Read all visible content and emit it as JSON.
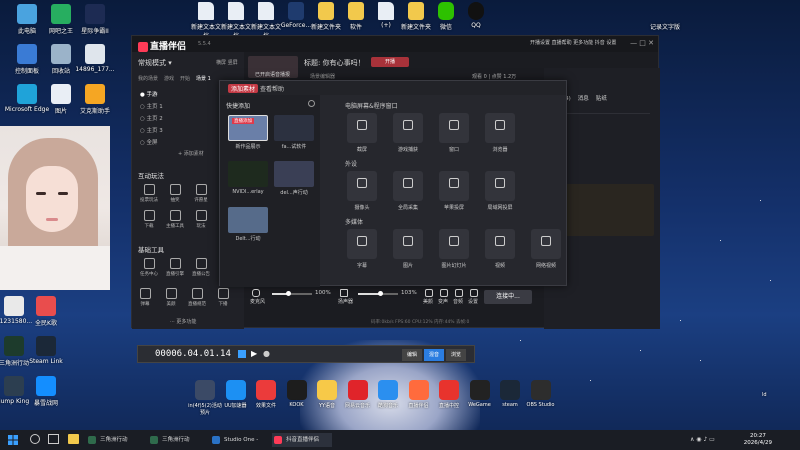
{
  "desktop_left": [
    {
      "label": "此电脑",
      "color": "#4aa3df"
    },
    {
      "label": "网吧之王",
      "color": "#27ae60"
    },
    {
      "label": "星际争霸II",
      "color": "#1d2b53"
    },
    {
      "label": "控制面板",
      "color": "#3a7bd5"
    },
    {
      "label": "回收站",
      "color": "#9bb3c9"
    },
    {
      "label": "14896_177...",
      "color": "#dfe5ec"
    },
    {
      "label": "Microsoft Edge",
      "color": "#1fa3d9"
    },
    {
      "label": "图片",
      "color": "#e9eef5"
    },
    {
      "label": "艾克斯助手",
      "color": "#f5a623"
    }
  ],
  "desktop_top": [
    {
      "label": "新建文本文档",
      "type": "file"
    },
    {
      "label": "新建文本文档",
      "type": "file"
    },
    {
      "label": "新建文本文档",
      "type": "file"
    },
    {
      "label": "GeForce...",
      "type": "app"
    },
    {
      "label": "新建文件夹",
      "type": "folder"
    },
    {
      "label": "软件",
      "type": "folder"
    },
    {
      "label": "(+)",
      "type": "file"
    },
    {
      "label": "新建文件夹",
      "type": "folder"
    },
    {
      "label": "微信",
      "type": "wechat"
    },
    {
      "label": "QQ",
      "type": "qq"
    }
  ],
  "desktop_top_right": "记录文字版",
  "desktop_lower": [
    {
      "label": "71231580...",
      "color": "#e9e9e9"
    },
    {
      "label": "全民K歌",
      "color": "#e94d4d"
    },
    {
      "label": "三角洲行动",
      "color": "#1d3b2c"
    },
    {
      "label": "Steam Link",
      "color": "#1b2838"
    },
    {
      "label": "Jump King",
      "color": "#2c3e50"
    },
    {
      "label": "暴雪战网",
      "color": "#148eff"
    }
  ],
  "app": {
    "name": "直播伴侣",
    "version": "5.5.4",
    "mode_label": "常规模式",
    "tabs_top": [
      "横屏",
      "竖屏"
    ],
    "left_tabs": [
      "我的场景",
      "游戏",
      "开始",
      "场景 1"
    ],
    "scenes": [
      "● 手游",
      "○ 主页 1",
      "○ 主页 2",
      "○ 主页 3",
      "○ 全屏"
    ],
    "add_material": "+ 添加素材",
    "section_interactive": "互动玩法",
    "section_tools": "基础工具",
    "tools_row1": [
      "投票玩法",
      "抽奖",
      "许愿星"
    ],
    "tools_row2": [
      "下载",
      "主播工具",
      "玩法"
    ],
    "tools_row3": [
      "任务中心",
      "直播引擎",
      "直播公告"
    ],
    "tools_row4": [
      "弹幕",
      "美颜",
      "直播规范",
      "下播"
    ],
    "more_features": "更多功能",
    "stream_title": "标题: 你有心事吗！",
    "stream_btn": "开播",
    "nav_items": [
      "开播设置",
      "直播帮助",
      "更多功能",
      "抖音",
      "设置"
    ],
    "stats": "观看 0 | 点赞 1.2万",
    "right_tabs": [
      "统计(4)",
      "消息",
      "贴纸"
    ],
    "preview_label": "已开启语音播报",
    "scene_label": "场景编辑器"
  },
  "popup": {
    "tabs": [
      "添加素材",
      "查看帮助"
    ],
    "quick_add": "快捷添加",
    "thumbnails": [
      {
        "label": "新作品展示",
        "badge": "直播添加",
        "color": "#6a7fa8"
      },
      {
        "label": "fa...试软件",
        "color": "#2c3140"
      },
      {
        "label": "NVIDI...erlay",
        "color": "#1e2a1e"
      },
      {
        "label": "del...声行动",
        "color": "#3a3f55"
      },
      {
        "label": "Delt...行动",
        "color": "#566b8a"
      }
    ],
    "group1": "电脑屏幕&程序窗口",
    "group1_items": [
      "截屏",
      "游戏捕获",
      "窗口",
      "浏览器"
    ],
    "group2": "外设",
    "group2_items": [
      "摄像头",
      "全局采集",
      "苹果投屏",
      "局域网投屏"
    ],
    "group3": "多媒体",
    "group3_items": [
      "字幕",
      "图片",
      "图片幻灯片",
      "视频",
      "网络视频"
    ]
  },
  "bottom": {
    "mic_label": "麦克风",
    "mic_pct": "100%",
    "spk_label": "扬声器",
    "spk_pct": "103%",
    "mic_level": 0.4,
    "spk_level": 0.55,
    "icons": [
      "美颜",
      "变声",
      "音频",
      "设置"
    ],
    "start_btn": "连接中...",
    "status_text": "码率:0kb/s  FPS:60  CPU:12%  内存:44%  丢帧:0"
  },
  "timeline": {
    "timecode": "00006.04.01.14",
    "tabs": [
      "编辑",
      "混音",
      "浏览"
    ]
  },
  "dock": [
    {
      "label": "in(4f)5(2)活动 预片",
      "color": "#3b4a66"
    },
    {
      "label": "UU加速器",
      "color": "#1c90f3"
    },
    {
      "label": "效果文件",
      "color": "#eb3b3b"
    },
    {
      "label": "KOOK",
      "color": "#1d1d1d"
    },
    {
      "label": "YY语音",
      "color": "#f7c948"
    },
    {
      "label": "网易云音乐",
      "color": "#e0242a"
    },
    {
      "label": "酷狗音乐",
      "color": "#2b8fef"
    },
    {
      "label": "直播伴侣",
      "color": "#ff6b3d"
    },
    {
      "label": "直播中控",
      "color": "#e8332d"
    },
    {
      "label": "WeGame",
      "color": "#222"
    },
    {
      "label": "steam",
      "color": "#1b2838"
    },
    {
      "label": "OBS Studio",
      "color": "#2d2d2d"
    }
  ],
  "dock_right": "ld",
  "taskbar": {
    "items": [
      {
        "label": "三角洲行动",
        "color": "#2f6b4c"
      },
      {
        "label": "三角洲行动",
        "color": "#2f6b4c"
      },
      {
        "label": "Studio One - Buc...",
        "color": "#2a72c5"
      },
      {
        "label": "抖音直播伴侣",
        "color": "#ff3b57"
      }
    ],
    "time": "20:27",
    "date": "2026/4/29"
  }
}
